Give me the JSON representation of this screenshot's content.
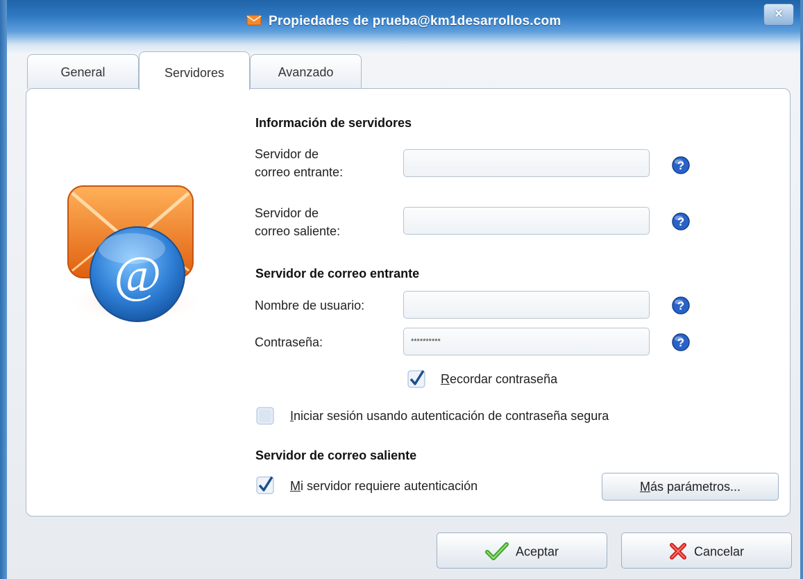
{
  "window": {
    "title": "Propiedades de prueba@km1desarrollos.com",
    "close_label": "×"
  },
  "tabs": [
    {
      "label": "General",
      "active": false
    },
    {
      "label": "Servidores",
      "active": true
    },
    {
      "label": "Avanzado",
      "active": false
    }
  ],
  "servers": {
    "section_title": "Información de servidores",
    "incoming_label_1": "Servidor de",
    "incoming_label_2": "correo entrante:",
    "incoming_value": "",
    "outgoing_label_1": "Servidor de",
    "outgoing_label_2": "correo saliente:",
    "outgoing_value": ""
  },
  "incoming": {
    "section_title": "Servidor de correo entrante",
    "username_label": "Nombre de usuario:",
    "username_value": "",
    "password_label": "Contraseña:",
    "password_value": "**********",
    "remember_label_key": "R",
    "remember_label_rest": "ecordar contraseña",
    "remember_checked": true,
    "secure_label_key": "I",
    "secure_label_rest": "niciar sesión usando autenticación de contraseña segura",
    "secure_checked": false
  },
  "outgoing": {
    "section_title": "Servidor de correo saliente",
    "auth_label_key": "M",
    "auth_label_rest": "i servidor requiere autenticación",
    "auth_checked": true,
    "more_params_key": "M",
    "more_params_rest": "ás parámetros..."
  },
  "footer": {
    "ok_label": "Aceptar",
    "cancel_label": "Cancelar"
  },
  "colors": {
    "title_bar": "#2f79c2",
    "help_icon": "#2a63c8",
    "check": "#1d4f8c",
    "envelope": "#f07b1e",
    "at_circle": "#2f7fd6"
  }
}
